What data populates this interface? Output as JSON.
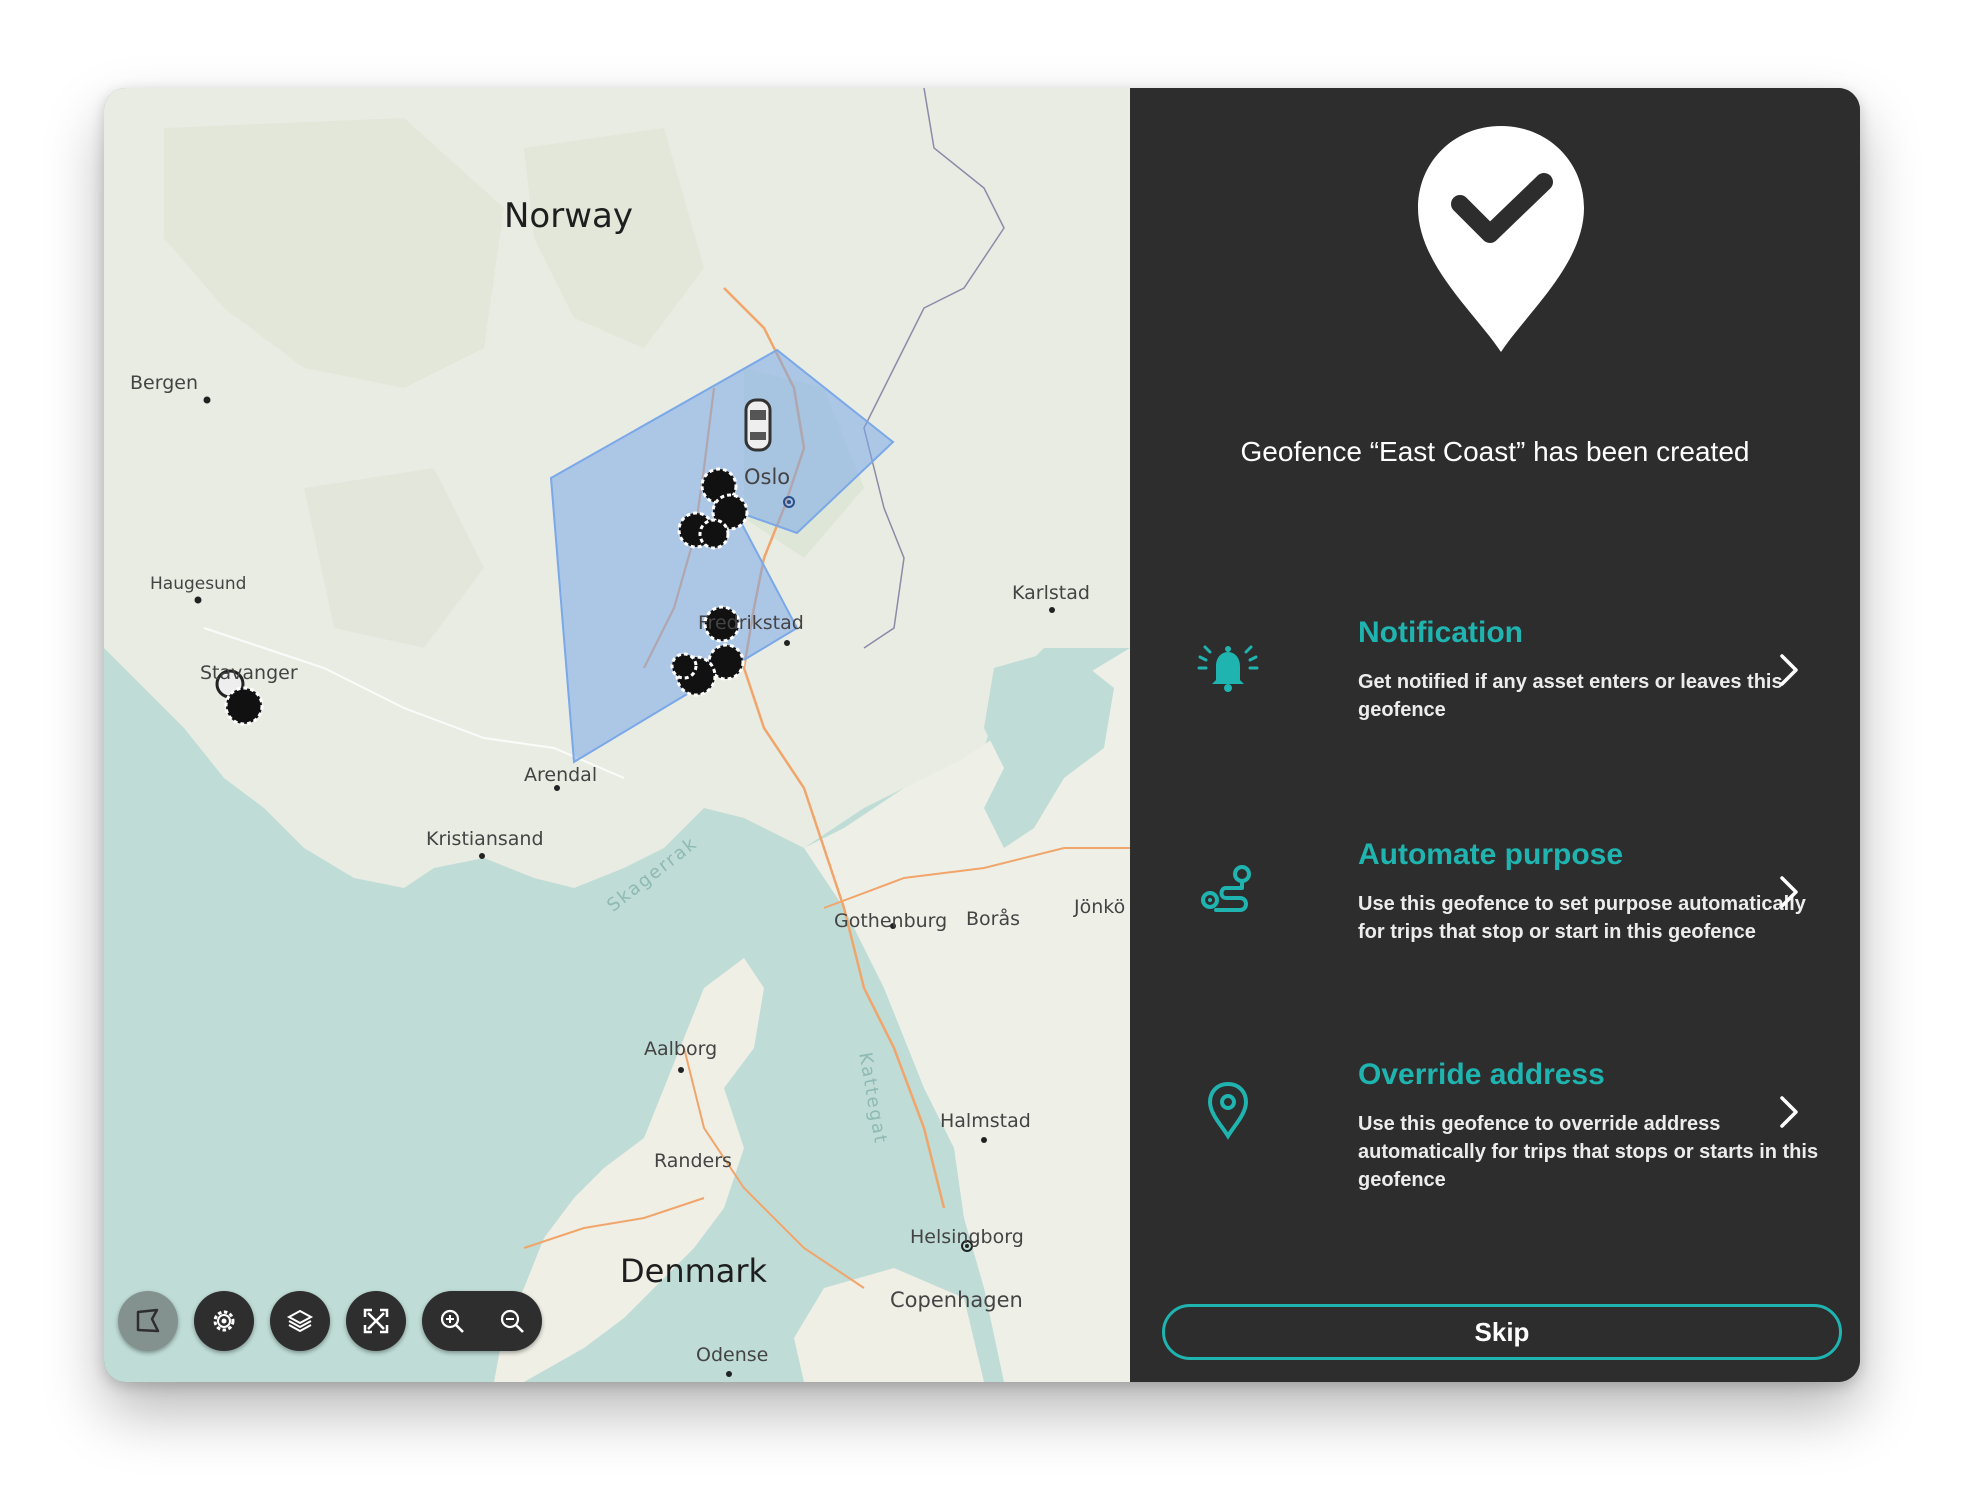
{
  "map": {
    "labels": {
      "norway": "Norway",
      "bergen": "Bergen",
      "haugesund": "Haugesund",
      "stavanger": "Stavanger",
      "oslo": "Oslo",
      "fredrikstad": "Fredrikstad",
      "karlstad": "Karlstad",
      "arendal": "Arendal",
      "kristiansand": "Kristiansand",
      "skagerrak": "Skagerrak",
      "gothenburg": "Gothenburg",
      "boras": "Borås",
      "jonkoping": "Jönkö",
      "aalborg": "Aalborg",
      "kattegat": "Kattegat",
      "halmstad": "Halmstad",
      "randers": "Randers",
      "denmark": "Denmark",
      "helsingborg": "Helsingborg",
      "copenhagen": "Copenhagen",
      "odense": "Odense"
    },
    "geofence_color": "#7aa8e8",
    "controls": [
      "draw-geofence-icon",
      "gear-icon",
      "layers-icon",
      "fullscreen-icon",
      "zoom-in-icon",
      "zoom-out-icon"
    ]
  },
  "panel": {
    "created_message": "Geofence “East Coast” has been created",
    "accent_color": "#1fb4b0",
    "options": [
      {
        "title": "Notification",
        "description": "Get notified if any asset enters or leaves this geofence",
        "icon": "bell-icon"
      },
      {
        "title": "Automate purpose",
        "description": "Use this geofence to set purpose automatically for trips that stop or start in this geofence",
        "icon": "route-icon"
      },
      {
        "title": "Override address",
        "description": "Use this geofence to override address automatically for trips that stops or starts in this geofence",
        "icon": "location-pin-icon"
      }
    ],
    "skip_label": "Skip"
  }
}
